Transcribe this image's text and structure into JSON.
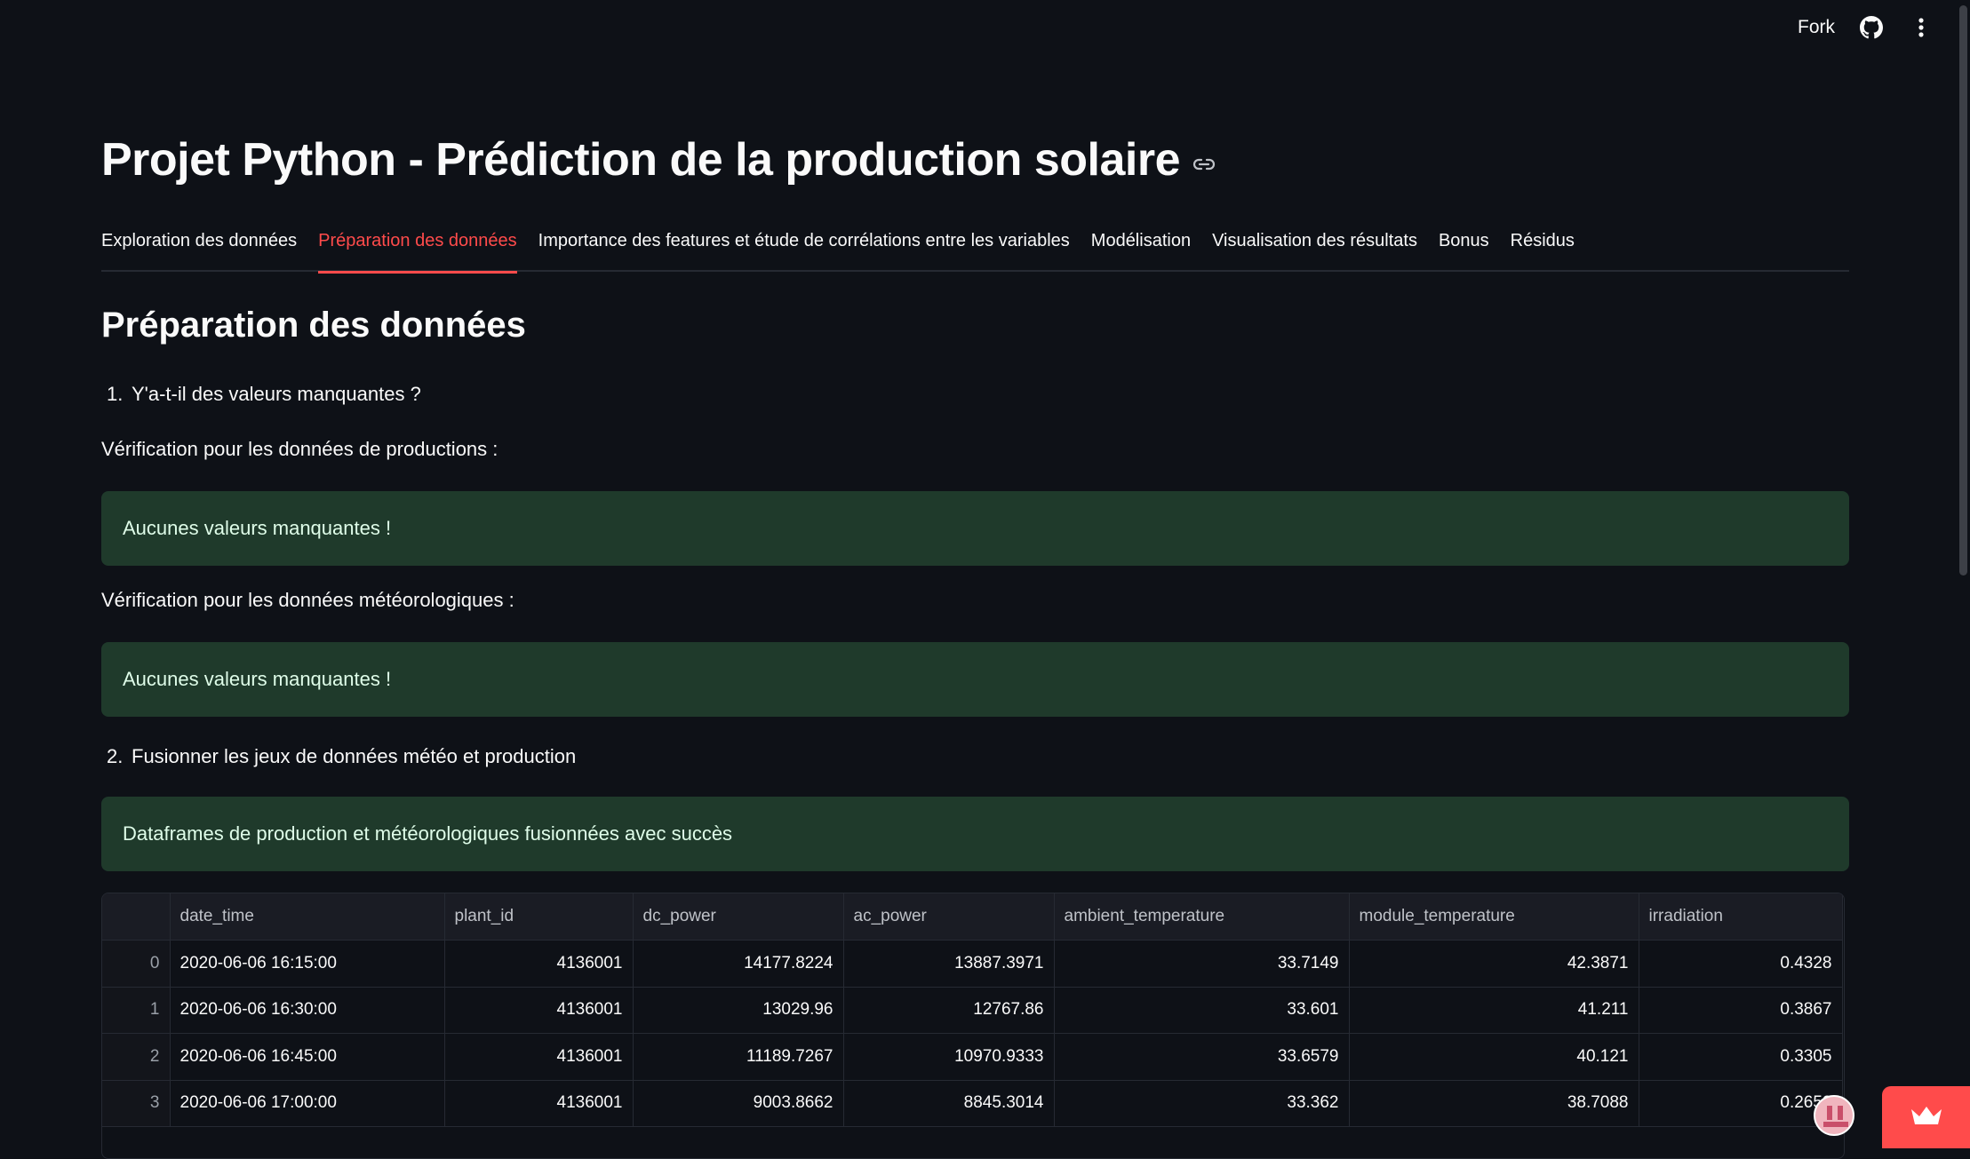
{
  "toolbar": {
    "fork_label": "Fork",
    "github_icon": "github-icon",
    "menu_icon": "kebab-menu-icon"
  },
  "page": {
    "title": "Projet Python - Prédiction de la production solaire",
    "title_link_icon": "link-icon"
  },
  "tabs": [
    {
      "label": "Exploration des données",
      "active": false
    },
    {
      "label": "Préparation des données",
      "active": true
    },
    {
      "label": "Importance des features et étude de corrélations entre les variables",
      "active": false
    },
    {
      "label": "Modélisation",
      "active": false
    },
    {
      "label": "Visualisation des résultats",
      "active": false
    },
    {
      "label": "Bonus",
      "active": false
    },
    {
      "label": "Résidus",
      "active": false
    }
  ],
  "content": {
    "section_title": "Préparation des données",
    "step1": {
      "number": "1.",
      "text": "Y'a-t-il des valeurs manquantes ?"
    },
    "check_production": "Vérification pour les données de productions :",
    "alert_production": "Aucunes valeurs manquantes !",
    "check_meteo": "Vérification pour les données météorologiques :",
    "alert_meteo": "Aucunes valeurs manquantes !",
    "step2": {
      "number": "2.",
      "text": "Fusionner les jeux de données météo et production"
    },
    "alert_merge": "Dataframes de production et météorologiques fusionnées avec succès"
  },
  "dataframe": {
    "columns": [
      "",
      "date_time",
      "plant_id",
      "dc_power",
      "ac_power",
      "ambient_temperature",
      "module_temperature",
      "irradiation"
    ],
    "rows": [
      [
        "0",
        "2020-06-06 16:15:00",
        "4136001",
        "14177.8224",
        "13887.3971",
        "33.7149",
        "42.3871",
        "0.4328"
      ],
      [
        "1",
        "2020-06-06 16:30:00",
        "4136001",
        "13029.96",
        "12767.86",
        "33.601",
        "41.211",
        "0.3867"
      ],
      [
        "2",
        "2020-06-06 16:45:00",
        "4136001",
        "11189.7267",
        "10970.9333",
        "33.6579",
        "40.121",
        "0.3305"
      ],
      [
        "3",
        "2020-06-06 17:00:00",
        "4136001",
        "9003.8662",
        "8845.3014",
        "33.362",
        "38.7088",
        "0.2652"
      ]
    ]
  },
  "colors": {
    "background": "#0e1117",
    "accent": "#ff4b4b",
    "success_bg": "#1f3a2b"
  }
}
